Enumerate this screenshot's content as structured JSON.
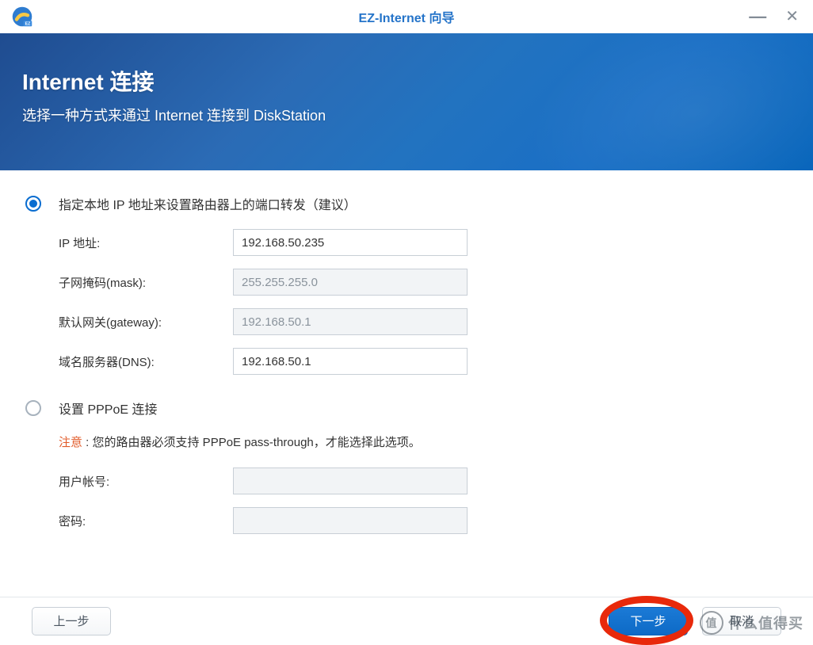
{
  "titlebar": {
    "title": "EZ-Internet 向导"
  },
  "header": {
    "title": "Internet 连接",
    "subtitle": "选择一种方式来通过 Internet 连接到 DiskStation"
  },
  "option1": {
    "label": "指定本地 IP 地址来设置路由器上的端口转发（建议）",
    "fields": {
      "ip_label": "IP 地址:",
      "ip_value": "192.168.50.235",
      "mask_label": "子网掩码(mask):",
      "mask_value": "255.255.255.0",
      "gateway_label": "默认网关(gateway):",
      "gateway_value": "192.168.50.1",
      "dns_label": "域名服务器(DNS):",
      "dns_value": "192.168.50.1"
    }
  },
  "option2": {
    "label": "设置 PPPoE 连接",
    "notice_label": "注意",
    "notice_text": " : 您的路由器必须支持 PPPoE pass-through，才能选择此选项。",
    "fields": {
      "username_label": "用户帐号:",
      "password_label": "密码:"
    }
  },
  "footer": {
    "back": "上一步",
    "next": "下一步",
    "cancel": "取消"
  },
  "watermark": {
    "badge": "值",
    "text": "什么值得买"
  }
}
